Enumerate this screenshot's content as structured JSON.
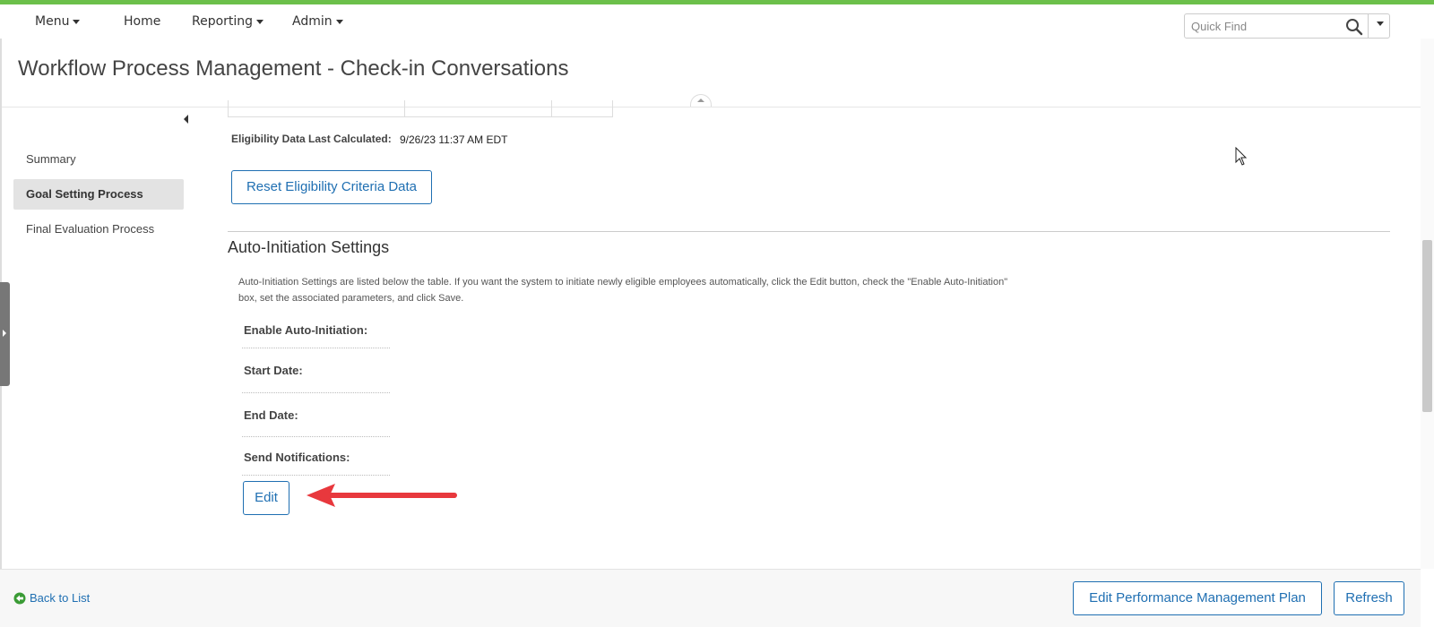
{
  "nav": {
    "menu": "Menu",
    "home": "Home",
    "reporting": "Reporting",
    "admin": "Admin"
  },
  "search": {
    "placeholder": "Quick Find"
  },
  "page_title": "Workflow Process Management - Check-in Conversations",
  "sidebar": {
    "items": [
      {
        "label": "Summary",
        "active": false
      },
      {
        "label": "Goal Setting Process",
        "active": true
      },
      {
        "label": "Final Evaluation Process",
        "active": false
      }
    ]
  },
  "eligibility": {
    "label": "Eligibility Data Last Calculated:",
    "value": "9/26/23 11:37 AM EDT",
    "reset_button": "Reset Eligibility Criteria Data"
  },
  "auto_init": {
    "title": "Auto-Initiation Settings",
    "description": "Auto-Initiation Settings are listed below the table. If you want the system to initiate newly eligible employees automatically, click the Edit button, check the \"Enable Auto-Initiation\" box, set the associated parameters, and click Save.",
    "fields": [
      {
        "label": "Enable Auto-Initiation:"
      },
      {
        "label": "Start Date:"
      },
      {
        "label": "End Date:"
      },
      {
        "label": "Send Notifications:"
      }
    ],
    "edit_button": "Edit"
  },
  "footer": {
    "back_link": "Back to List",
    "edit_plan_button": "Edit Performance Management Plan",
    "refresh_button": "Refresh"
  },
  "colors": {
    "accent_green": "#6cc04a",
    "link_blue": "#1f6fb2",
    "annotation_red": "#e8383d"
  }
}
